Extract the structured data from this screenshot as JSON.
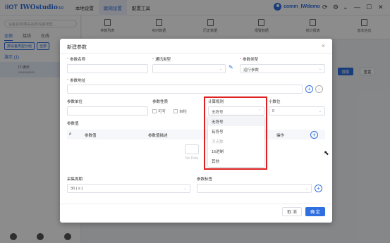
{
  "app": {
    "brand": "iIOT",
    "name": "IWOstudio",
    "version": "3.0",
    "nav": [
      "本地设置",
      "联网设置",
      "配置工具"
    ],
    "nav_active": 1,
    "user": "comm_IWdemo"
  },
  "sidebar": {
    "search_placeholder": "设备名称/网关名称/设备类型...",
    "tabs": [
      "全部",
      "接线",
      "在线"
    ],
    "filters": [
      "按设备类型分组",
      "全部"
    ],
    "group_label": "演示 (1)",
    "device_name": "IT-演示",
    "device_id": "W040M0005"
  },
  "toolbar": {
    "items": [
      "参数列表",
      "实时数据",
      "历史数据",
      "报警数据",
      "统计报表",
      "基本信息"
    ],
    "search_btn": "搜索",
    "reset_btn": "重置"
  },
  "dialog": {
    "title": "新建参数",
    "fields": {
      "param_name": "参数名称",
      "comm_type": "通讯类型",
      "param_type": "参数类型",
      "param_type_value": "运行参数",
      "param_addr": "参数地址",
      "param_unit": "参数单位",
      "param_prop": "参数性质",
      "prop_read": "可写",
      "prop_write": "自检",
      "calc_rule": "计算规则",
      "calc_rule_value": "无符号",
      "decimals": "小数位",
      "decimals_value": "0",
      "param_value": "参数值",
      "col_index": "#",
      "col_value": "参数值",
      "col_desc": "参数值描述",
      "col_action": "操作",
      "nodata": "No Data",
      "sample_period": "采集周期",
      "sample_period_value": "30 ( s )",
      "param_tag": "参数标签"
    },
    "dropdown_options": [
      "无符号",
      "有符号",
      "浮点数",
      "16进制",
      "其他"
    ],
    "dropdown_selected": 0,
    "dropdown_disabled": [
      2
    ],
    "cancel": "取 消",
    "ok": "确 定"
  }
}
